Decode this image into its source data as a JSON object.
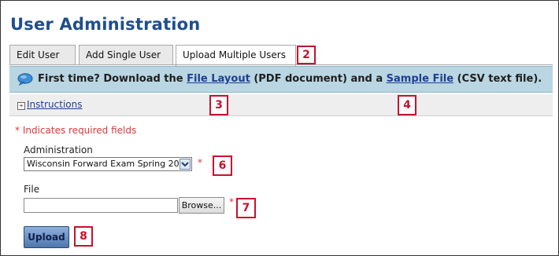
{
  "page": {
    "title": "User Administration"
  },
  "tabs": [
    {
      "label": "Edit User"
    },
    {
      "label": "Add Single User"
    },
    {
      "label": "Upload Multiple Users",
      "active": true
    }
  ],
  "info_bar": {
    "prefix": "First time? Download the",
    "layout_link": "File Layout",
    "middle": "(PDF document) and a",
    "sample_link": "Sample File",
    "suffix": "(CSV text file).",
    "icon": "speech-bubble-icon"
  },
  "instructions": {
    "toggle_icon": "plus-expand-icon",
    "toggle_symbol": "+",
    "label": "Instructions"
  },
  "form": {
    "required_note": "* Indicates required fields",
    "administration_label": "Administration",
    "administration_value": "Wisconsin Forward Exam Spring 20",
    "required_marker": "*",
    "file_label": "File",
    "file_value": "",
    "browse_label": "Browse...",
    "upload_label": "Upload"
  },
  "callouts": [
    "2",
    "3",
    "4",
    "6",
    "7",
    "8"
  ],
  "colors": {
    "title": "#1f4e8c",
    "info_bar": "#b9d6e2",
    "required": "#d93a3a",
    "callout": "#c8102e",
    "upload_button": "#4f76ad"
  }
}
